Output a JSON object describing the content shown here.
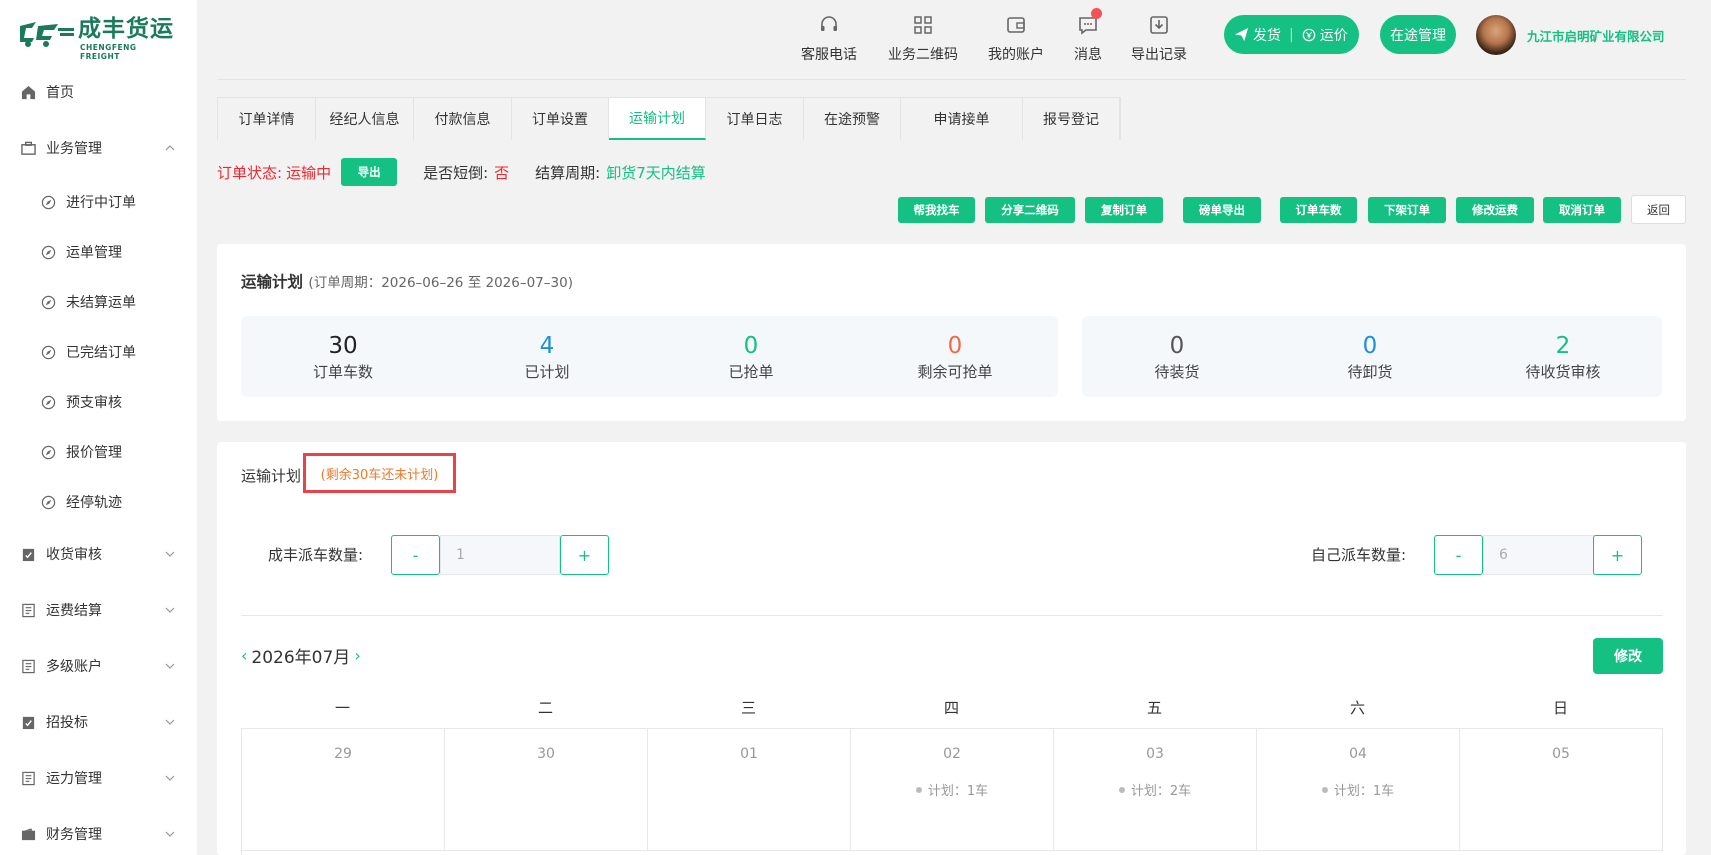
{
  "brand": {
    "name": "成丰货运",
    "sub": "CHENGFENG FREIGHT"
  },
  "sidebar": {
    "items": [
      {
        "label": "首页",
        "icon": "home-icon"
      },
      {
        "label": "业务管理",
        "icon": "briefcase-icon",
        "expanded": true
      },
      {
        "label": "收货审核",
        "icon": "clipboard-check-icon"
      },
      {
        "label": "运费结算",
        "icon": "document-icon"
      },
      {
        "label": "多级账户",
        "icon": "document-icon"
      },
      {
        "label": "招投标",
        "icon": "clipboard-check-icon"
      },
      {
        "label": "运力管理",
        "icon": "document-icon"
      },
      {
        "label": "财务管理",
        "icon": "wallet-icon"
      }
    ],
    "subitems": [
      "进行中订单",
      "运单管理",
      "未结算运单",
      "已完结订单",
      "预支审核",
      "报价管理",
      "经停轨迹"
    ]
  },
  "header": {
    "tools": [
      {
        "label": "客服电话",
        "icon": "headset-icon"
      },
      {
        "label": "业务二维码",
        "icon": "qrcode-icon"
      },
      {
        "label": "我的账户",
        "icon": "wallet-icon"
      },
      {
        "label": "消息",
        "icon": "message-icon"
      },
      {
        "label": "导出记录",
        "icon": "export-icon"
      }
    ],
    "ship_label": "发货",
    "price_label": "运价",
    "transit_label": "在途管理",
    "company": "九江市启明矿业有限公司"
  },
  "tabs": [
    "订单详情",
    "经纪人信息",
    "付款信息",
    "订单设置",
    "运输计划",
    "订单日志",
    "在途预警",
    "申请接单",
    "报号登记"
  ],
  "active_tab": "运输计划",
  "status": {
    "order_status_label": "订单状态:",
    "order_status_value": "运输中",
    "export_label": "导出",
    "short_label": "是否短倒:",
    "short_value": "否",
    "cycle_label": "结算周期:",
    "cycle_value": "卸货7天内结算"
  },
  "actions": [
    "帮我找车",
    "分享二维码",
    "复制订单",
    "磅单导出",
    "订单车数",
    "下架订单",
    "修改运费",
    "取消订单",
    "返回"
  ],
  "plan_summary": {
    "title": "运输计划",
    "period": "(订单周期：2026–06–26 至 2026–07–30)",
    "stats_left": [
      {
        "value": "30",
        "label": "订单车数",
        "color": "#222222"
      },
      {
        "value": "4",
        "label": "已计划",
        "color": "#1f8fdb"
      },
      {
        "value": "0",
        "label": "已抢单",
        "color": "#15c083"
      },
      {
        "value": "0",
        "label": "剩余可抢单",
        "color": "#f06a4a"
      }
    ],
    "stats_right": [
      {
        "value": "0",
        "label": "待装货",
        "color": "#555555"
      },
      {
        "value": "0",
        "label": "待卸货",
        "color": "#1f8fdb"
      },
      {
        "value": "2",
        "label": "待收货审核",
        "color": "#15c083"
      }
    ]
  },
  "plan": {
    "title": "运输计划",
    "remain": "(剩余30车还未计划)",
    "chengfeng_label": "成丰派车数量:",
    "chengfeng_value": "1",
    "self_label": "自己派车数量:",
    "self_value": "6",
    "minus": "-",
    "plus": "+",
    "month": "2026年07月",
    "prev": "‹",
    "next": "›",
    "edit_label": "修改",
    "weekdays": [
      "一",
      "二",
      "三",
      "四",
      "五",
      "六",
      "日"
    ],
    "days": [
      {
        "date": "29",
        "plan": ""
      },
      {
        "date": "30",
        "plan": ""
      },
      {
        "date": "01",
        "plan": ""
      },
      {
        "date": "02",
        "plan": "计划：1车"
      },
      {
        "date": "03",
        "plan": "计划：2车"
      },
      {
        "date": "04",
        "plan": "计划：1车"
      },
      {
        "date": "05",
        "plan": ""
      }
    ]
  },
  "colors": {
    "accent": "#15c083",
    "danger": "#f0292f",
    "warn": "#ee7a2c"
  }
}
